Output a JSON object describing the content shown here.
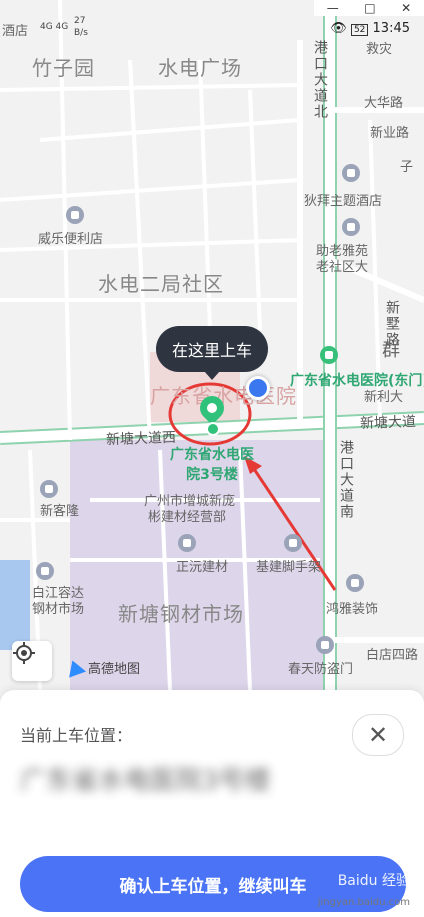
{
  "window_controls": [
    "—",
    "□",
    "✕"
  ],
  "status_bar": {
    "carrier_top": "酒店",
    "network": "4G 4G",
    "speed_value": "27",
    "speed_unit": "B/s",
    "battery": "52",
    "time": "13:45"
  },
  "map": {
    "areas": [
      "竹子园",
      "水电广场",
      "水电二局社区",
      "新塘钢材市场"
    ],
    "roads": [
      "新塘大道西",
      "新塘大道"
    ],
    "vertical_roads": [
      "港口大道北",
      "港口大道南",
      "新墅路"
    ],
    "places": [
      "大华路",
      "新业路",
      "子",
      "狄拜主题酒店",
      "威乐便利店",
      "助老雅苑",
      "老社区大",
      "新客隆",
      "广州市增城新庞",
      "彬建材经营部",
      "正沅建材",
      "基建脚手架",
      "白江容达",
      "钢材市场",
      "鸿雅装饰",
      "白店四路",
      "春天防盗门",
      "新利大",
      "群",
      "救灾"
    ],
    "hospital_label": "广东省水电医院",
    "green_labels": [
      "广东省水电医院(东门)",
      "广东省水电医院3号楼"
    ],
    "pickup_bubble": "在这里上车",
    "logo_text": "高德地图"
  },
  "panel": {
    "title": "当前上车位置：",
    "address": "广东省水电医院3号楼",
    "close_label": "✕",
    "confirm_button": "确认上车位置，继续叫车"
  },
  "watermark": {
    "brand": "Baidu 经验",
    "url": "jingyan.baidu.com"
  }
}
